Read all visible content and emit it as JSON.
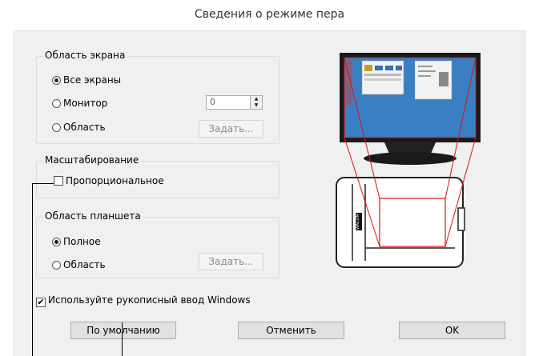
{
  "dialog": {
    "title": "Сведения о режиме пера"
  },
  "screen_area": {
    "legend": "Область экрана",
    "options": [
      {
        "label": "Все экраны",
        "selected": true
      },
      {
        "label": "Монитор",
        "selected": false
      },
      {
        "label": "Область",
        "selected": false
      }
    ],
    "monitor_value": "0",
    "set_button": "Задать..."
  },
  "scaling": {
    "legend": "Масштабирование",
    "proportional_label": "Пропорциональное",
    "proportional_checked": false
  },
  "tablet_area": {
    "legend": "Область планшета",
    "options": [
      {
        "label": "Полное",
        "selected": true
      },
      {
        "label": "Область",
        "selected": false
      }
    ],
    "set_button": "Задать..."
  },
  "windows_ink": {
    "label": "Используйте рукописный ввод Windows",
    "checked": true,
    "check_glyph": "✔"
  },
  "buttons": {
    "default": "По умолчанию",
    "cancel": "Отменить",
    "ok": "OK"
  },
  "illustration": {
    "tablet_brand": "WACOM",
    "screen_color": "#3a7fc4",
    "mapping_color": "#e01010"
  }
}
